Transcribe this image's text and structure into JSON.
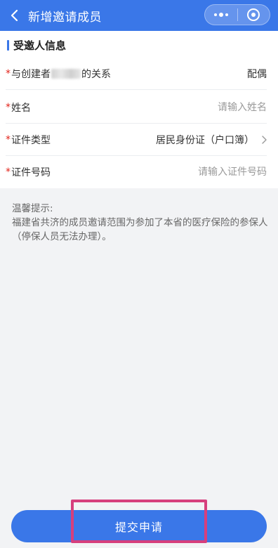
{
  "header": {
    "title": "新增邀请成员",
    "background": "#3a77e8"
  },
  "section": {
    "title": "受邀人信息"
  },
  "form": {
    "relation": {
      "label_prefix": "与创建者",
      "label_suffix": "的关系",
      "value": "配偶"
    },
    "name": {
      "label": "姓名",
      "placeholder": "请输入姓名"
    },
    "id_type": {
      "label": "证件类型",
      "value": "居民身份证（户口簿）"
    },
    "id_number": {
      "label": "证件号码",
      "placeholder": "请输入证件号码"
    },
    "required_mark": "*"
  },
  "tip": {
    "heading": "温馨提示:",
    "body": "福建省共济的成员邀请范围为参加了本省的医疗保险的参保人（停保人员无法办理）。"
  },
  "submit": {
    "label": "提交申请"
  },
  "icons": [
    "back-arrow-icon",
    "more-dots-icon",
    "close-target-icon",
    "chevron-right-icon"
  ],
  "colors": {
    "primary": "#3a77e8",
    "required": "#e2231a",
    "highlight": "#d63f7d",
    "background": "#f2f3f5"
  }
}
